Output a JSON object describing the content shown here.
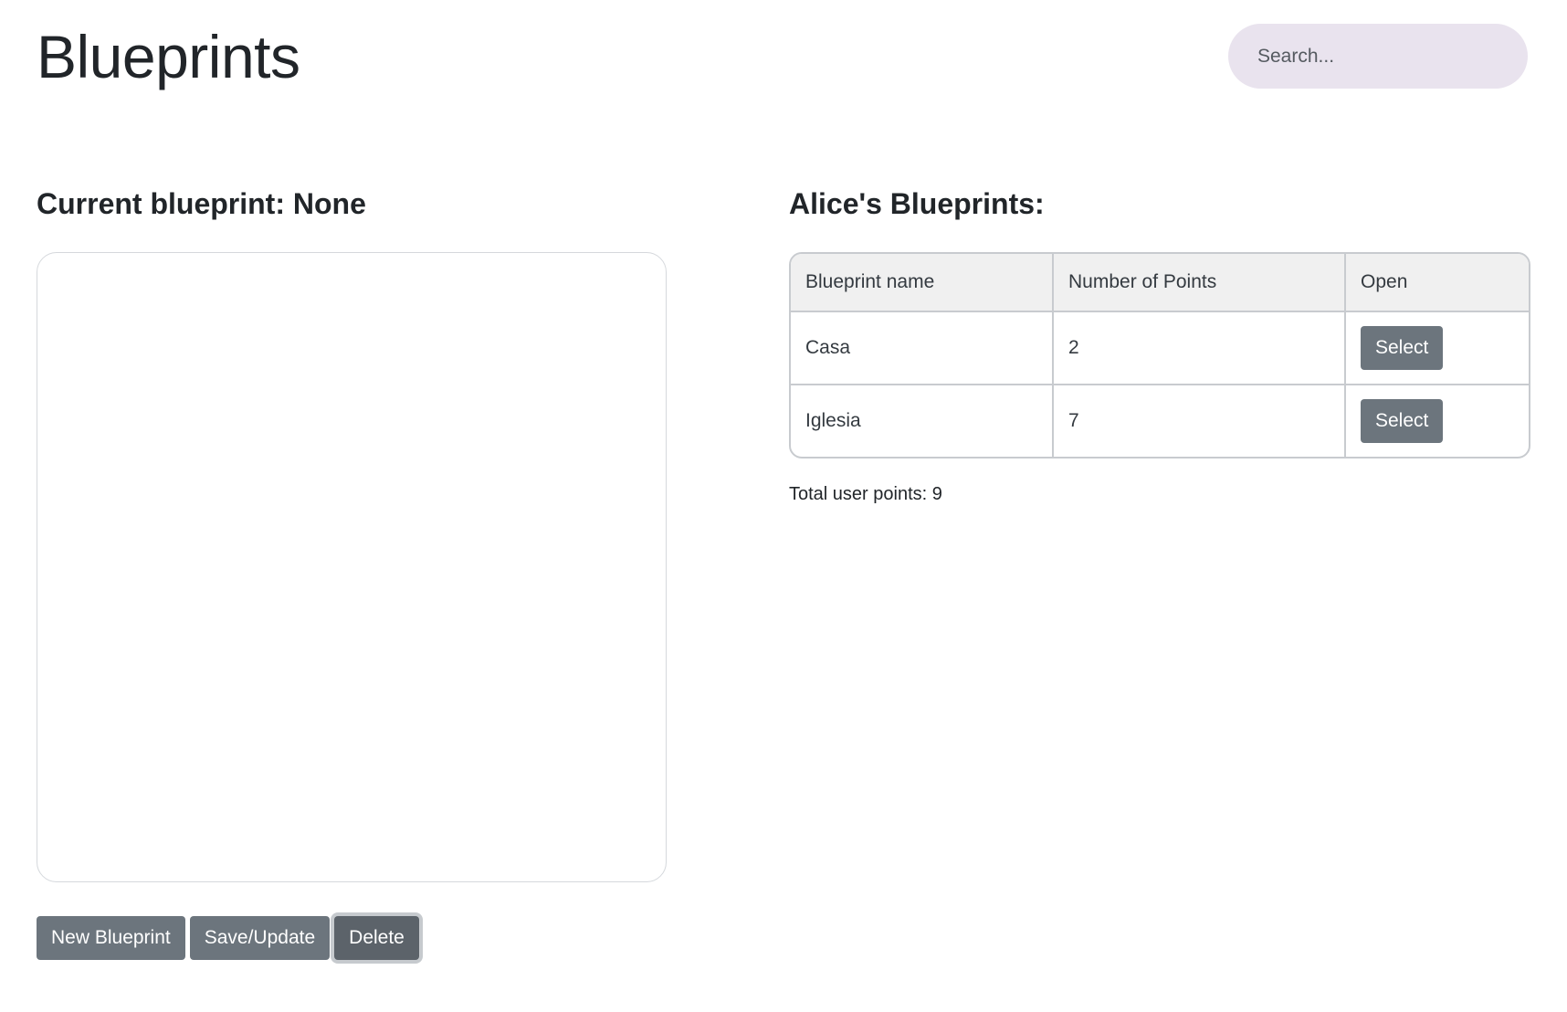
{
  "header": {
    "title": "Blueprints"
  },
  "search": {
    "placeholder": "Search...",
    "value": ""
  },
  "current": {
    "heading": "Current blueprint: None"
  },
  "actions": {
    "new_label": "New Blueprint",
    "save_label": "Save/Update",
    "delete_label": "Delete"
  },
  "blueprints": {
    "heading": "Alice's Blueprints:",
    "columns": [
      "Blueprint name",
      "Number of Points",
      "Open"
    ],
    "rows": [
      {
        "name": "Casa",
        "points": "2",
        "action": "Select"
      },
      {
        "name": "Iglesia",
        "points": "7",
        "action": "Select"
      }
    ],
    "total_text": "Total user points: 9"
  },
  "colors": {
    "button": "#6c757d",
    "search_bg": "#e9e3ee",
    "table_header_bg": "#f0f0f0"
  }
}
